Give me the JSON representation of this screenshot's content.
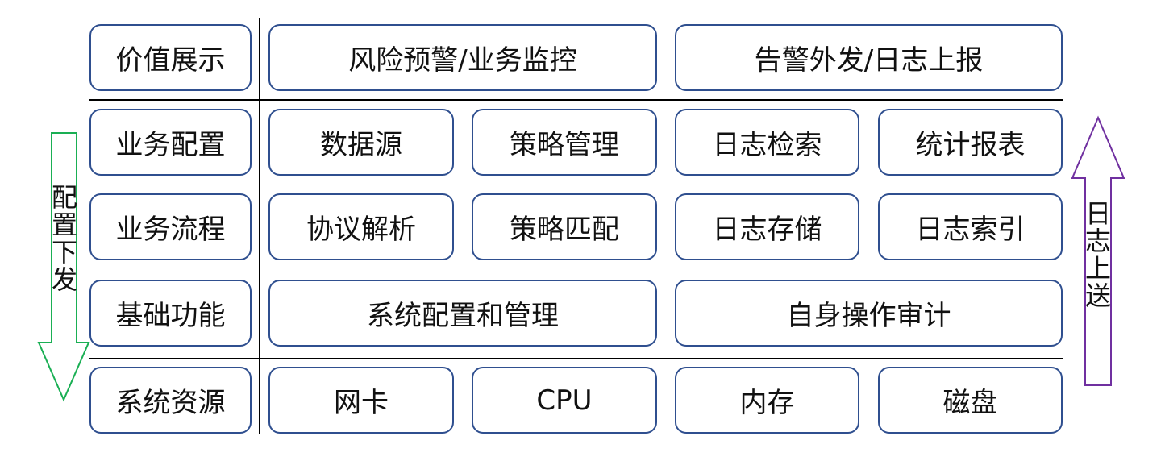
{
  "rows": [
    {
      "label": "价值展示",
      "items": [
        "风险预警/业务监控",
        "告警外发/日志上报"
      ]
    },
    {
      "label": "业务配置",
      "items": [
        "数据源",
        "策略管理",
        "日志检索",
        "统计报表"
      ]
    },
    {
      "label": "业务流程",
      "items": [
        "协议解析",
        "策略匹配",
        "日志存储",
        "日志索引"
      ]
    },
    {
      "label": "基础功能",
      "items": [
        "系统配置和管理",
        "自身操作审计"
      ]
    },
    {
      "label": "系统资源",
      "items": [
        "网卡",
        "CPU",
        "内存",
        "磁盘"
      ]
    }
  ],
  "arrows": {
    "down": {
      "label": "配置下发",
      "color": "#1aaf54"
    },
    "up": {
      "label": "日志上送",
      "color": "#7030a0"
    }
  },
  "colors": {
    "box_border": "#2f4f8f"
  }
}
